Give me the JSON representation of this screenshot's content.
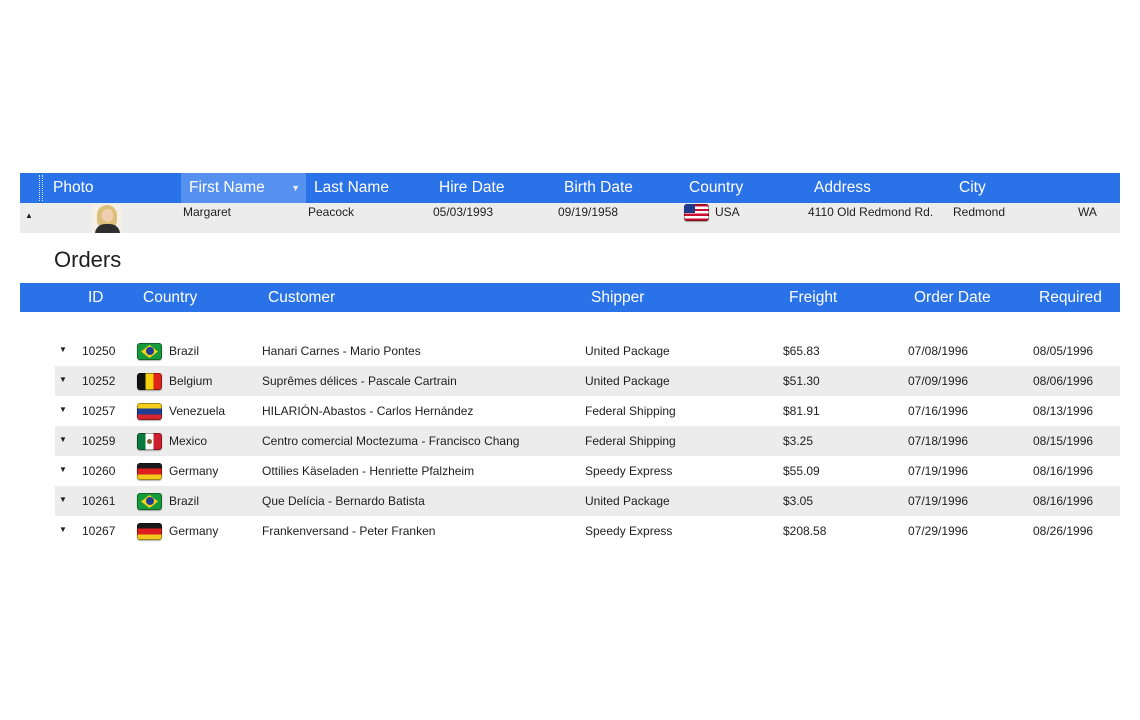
{
  "employees": {
    "columns": {
      "photo": "Photo",
      "first_name": "First Name",
      "last_name": "Last Name",
      "hire_date": "Hire Date",
      "birth_date": "Birth Date",
      "country": "Country",
      "address": "Address",
      "city": "City"
    },
    "sorted_column": "first_name",
    "row": {
      "first_name": "Margaret",
      "last_name": "Peacock",
      "hire_date": "05/03/1993",
      "birth_date": "09/19/1958",
      "country": "USA",
      "country_flag": "usa-flag-icon",
      "address": "4110 Old Redmond Rd.",
      "city": "Redmond",
      "region": "WA",
      "expander_glyph": "▲"
    }
  },
  "orders": {
    "title": "Orders",
    "columns": {
      "id": "ID",
      "country": "Country",
      "customer": "Customer",
      "shipper": "Shipper",
      "freight": "Freight",
      "order_date": "Order Date",
      "required": "Required"
    },
    "expander_glyph": "▼",
    "rows": [
      {
        "id": "10250",
        "country": "Brazil",
        "flag": "brazil",
        "customer": "Hanari Carnes - Mario Pontes",
        "shipper": "United Package",
        "freight": "$65.83",
        "order_date": "07/08/1996",
        "required": "08/05/1996"
      },
      {
        "id": "10252",
        "country": "Belgium",
        "flag": "belgium",
        "customer": "Suprêmes délices - Pascale Cartrain",
        "shipper": "United Package",
        "freight": "$51.30",
        "order_date": "07/09/1996",
        "required": "08/06/1996"
      },
      {
        "id": "10257",
        "country": "Venezuela",
        "flag": "venezuela",
        "customer": "HILARIÓN-Abastos - Carlos Hernández",
        "shipper": "Federal Shipping",
        "freight": "$81.91",
        "order_date": "07/16/1996",
        "required": "08/13/1996"
      },
      {
        "id": "10259",
        "country": "Mexico",
        "flag": "mexico",
        "customer": "Centro comercial Moctezuma - Francisco Chang",
        "shipper": "Federal Shipping",
        "freight": "$3.25",
        "order_date": "07/18/1996",
        "required": "08/15/1996"
      },
      {
        "id": "10260",
        "country": "Germany",
        "flag": "germany",
        "customer": "Ottilies Käseladen - Henriette Pfalzheim",
        "shipper": "Speedy Express",
        "freight": "$55.09",
        "order_date": "07/19/1996",
        "required": "08/16/1996"
      },
      {
        "id": "10261",
        "country": "Brazil",
        "flag": "brazil",
        "customer": "Que Delícia - Bernardo Batista",
        "shipper": "United Package",
        "freight": "$3.05",
        "order_date": "07/19/1996",
        "required": "08/16/1996"
      },
      {
        "id": "10267",
        "country": "Germany",
        "flag": "germany",
        "customer": "Frankenversand - Peter Franken",
        "shipper": "Speedy Express",
        "freight": "$208.58",
        "order_date": "07/29/1996",
        "required": "08/26/1996"
      }
    ]
  },
  "colors": {
    "header_blue": "#2a72e8",
    "sorted_header": "#5691f0",
    "row_alt": "#ececec"
  }
}
